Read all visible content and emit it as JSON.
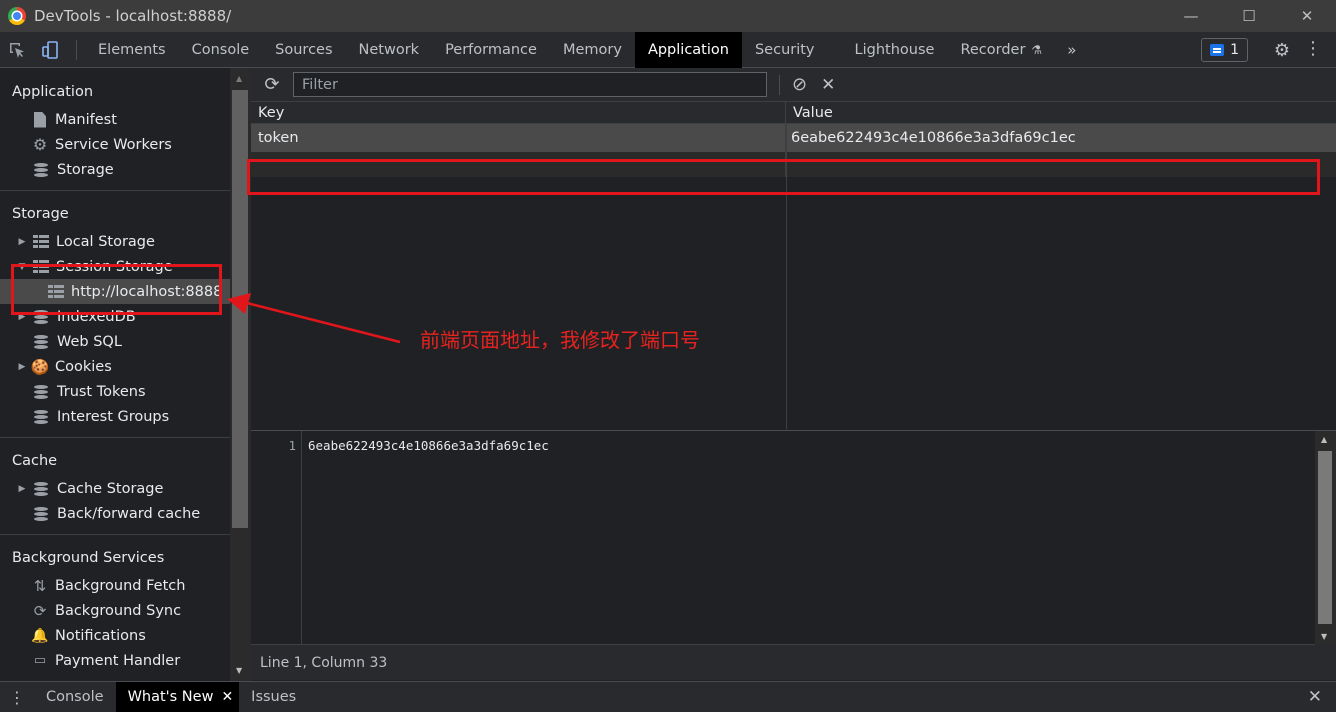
{
  "window": {
    "title": "DevTools - localhost:8888/",
    "minimize": "—",
    "maximize": "☐",
    "close": "✕"
  },
  "tabs": [
    "Elements",
    "Console",
    "Sources",
    "Network",
    "Performance",
    "Memory",
    "Application",
    "Security",
    "Lighthouse",
    "Recorder"
  ],
  "active_tab": "Application",
  "tab_more": "»",
  "issues_count": "1",
  "sidebar": {
    "application": {
      "title": "Application",
      "items": [
        "Manifest",
        "Service Workers",
        "Storage"
      ]
    },
    "storage": {
      "title": "Storage",
      "local_storage": "Local Storage",
      "session_storage": "Session Storage",
      "session_origin": "http://localhost:8888",
      "indexeddb": "IndexedDB",
      "websql": "Web SQL",
      "cookies": "Cookies",
      "trust_tokens": "Trust Tokens",
      "interest_groups": "Interest Groups"
    },
    "cache": {
      "title": "Cache",
      "cache_storage": "Cache Storage",
      "bfcache": "Back/forward cache"
    },
    "background": {
      "title": "Background Services",
      "fetch": "Background Fetch",
      "sync": "Background Sync",
      "notifications": "Notifications",
      "payment": "Payment Handler"
    }
  },
  "filter": {
    "placeholder": "Filter",
    "value": ""
  },
  "table": {
    "headers": {
      "key": "Key",
      "value": "Value"
    },
    "rows": [
      {
        "key": "token",
        "value": "6eabe622493c4e10866e3a3dfa69c1ec"
      }
    ]
  },
  "preview": {
    "line_number": "1",
    "content": "6eabe622493c4e10866e3a3dfa69c1ec",
    "status": "Line 1, Column 33"
  },
  "drawer": {
    "tabs": [
      "Console",
      "What's New",
      "Issues"
    ],
    "active": "What's New"
  },
  "annotation": {
    "text": "前端页面地址，我修改了端口号",
    "color": "#e0161b"
  }
}
